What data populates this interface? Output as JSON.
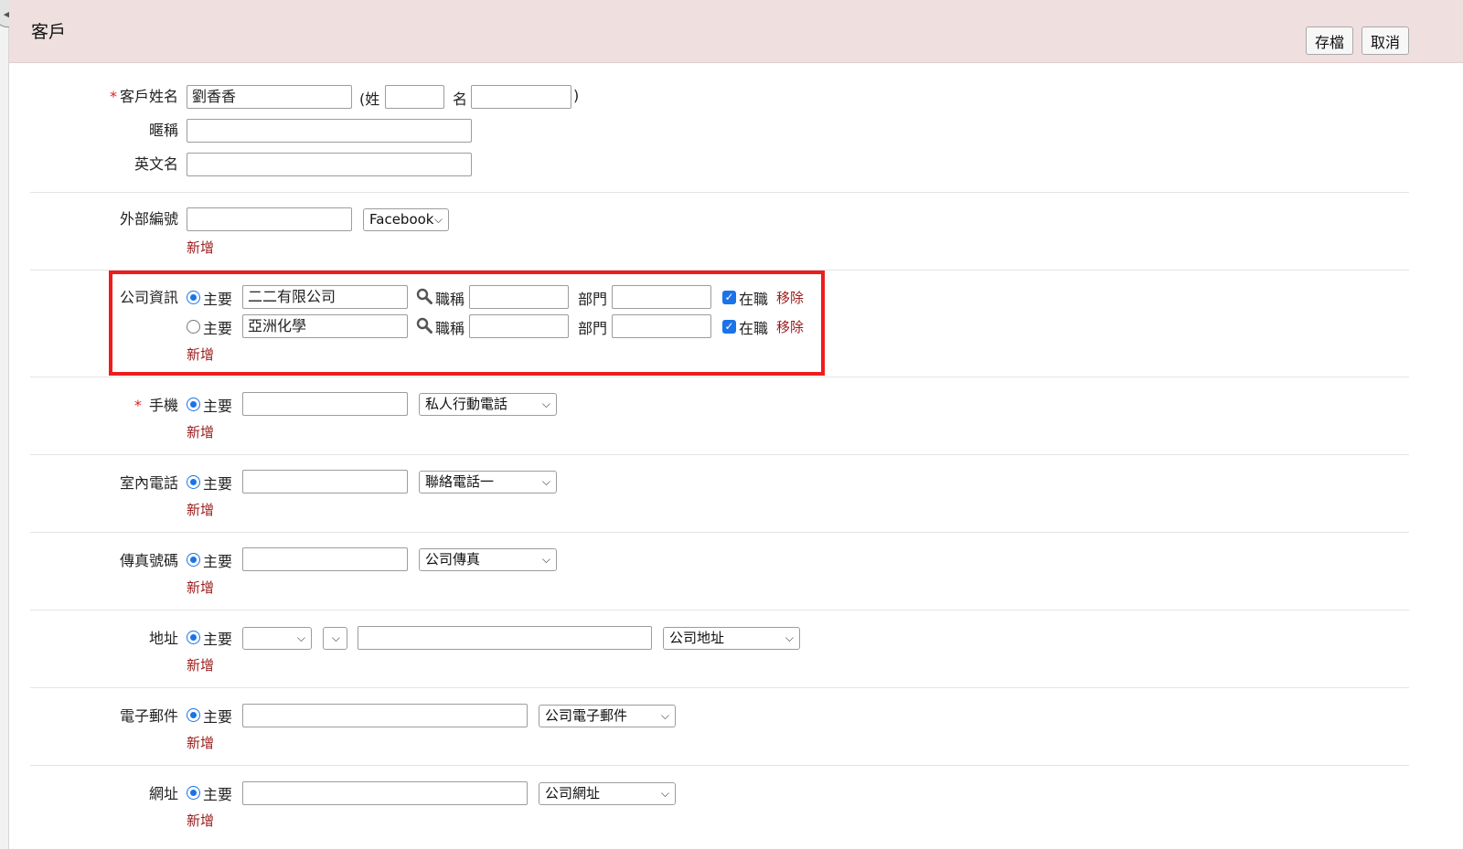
{
  "header": {
    "title": "客戶",
    "save_label": "存檔",
    "cancel_label": "取消"
  },
  "name_section": {
    "customer_name_label": "客戶姓名",
    "customer_name_value": "劉香香",
    "open_paren_surname": "(姓",
    "given_name_label": "名",
    "close_paren": ")",
    "nickname_label": "暱稱",
    "english_name_label": "英文名"
  },
  "external_id": {
    "label": "外部編號",
    "source_select": "Facebook",
    "add_link": "新增"
  },
  "company_info": {
    "label": "公司資訊",
    "rows": [
      {
        "primary_label": "主要",
        "company": "二二有限公司",
        "title_label": "職稱",
        "dept_label": "部門",
        "employed_label": "在職",
        "remove_link": "移除",
        "primary": true
      },
      {
        "primary_label": "主要",
        "company": "亞洲化學",
        "title_label": "職稱",
        "dept_label": "部門",
        "employed_label": "在職",
        "remove_link": "移除",
        "primary": false
      }
    ],
    "add_link": "新增"
  },
  "mobile": {
    "label": "手機",
    "primary_label": "主要",
    "type_select": "私人行動電話",
    "add_link": "新增"
  },
  "landline": {
    "label": "室內電話",
    "primary_label": "主要",
    "type_select": "聯絡電話一",
    "add_link": "新增"
  },
  "fax": {
    "label": "傳真號碼",
    "primary_label": "主要",
    "type_select": "公司傳真",
    "add_link": "新增"
  },
  "address": {
    "label": "地址",
    "primary_label": "主要",
    "type_select": "公司地址",
    "add_link": "新增"
  },
  "email": {
    "label": "電子郵件",
    "primary_label": "主要",
    "type_select": "公司電子郵件",
    "add_link": "新增"
  },
  "website": {
    "label": "網址",
    "primary_label": "主要",
    "type_select": "公司網址",
    "add_link": "新增"
  }
}
